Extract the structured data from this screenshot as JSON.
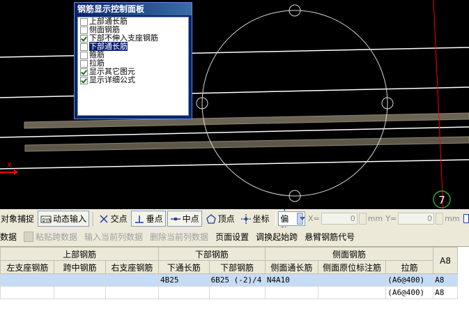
{
  "panel": {
    "title": "钢筋显示控制面板",
    "items": [
      {
        "label": "上部通长筋",
        "checked": false,
        "selected": false
      },
      {
        "label": "侧面钢筋",
        "checked": false,
        "selected": false
      },
      {
        "label": "下部不伸入支座钢筋",
        "checked": true,
        "selected": false
      },
      {
        "label": "下部通长筋",
        "checked": false,
        "selected": true
      },
      {
        "label": "箍筋",
        "checked": false,
        "selected": false
      },
      {
        "label": "拉筋",
        "checked": false,
        "selected": false
      },
      {
        "label": "显示其它图元",
        "checked": true,
        "selected": false
      },
      {
        "label": "显示详细公式",
        "checked": true,
        "selected": false
      }
    ]
  },
  "canvas": {
    "axis_label": "X",
    "marker_label": "7",
    "colors": {
      "bg": "#000000",
      "lines": "#ffffff",
      "beam": "#6b6454",
      "axis": "#ff0000",
      "marker": "#2ea82e"
    }
  },
  "toolbar": {
    "snap": "对象捕捉",
    "dynamic_input": "动态输入",
    "intersection": "交点",
    "perpendicular": "垂点",
    "midpoint": "中点",
    "vertex": "顶点",
    "coordinate": "坐标",
    "offset_mode": "不偏移",
    "x_label": "X=",
    "x_value": "0",
    "y_label": "Y=",
    "y_value": "0",
    "unit": "mm"
  },
  "commands": [
    {
      "label": "数据",
      "enabled": true
    },
    {
      "label": "粘贴跨数据",
      "enabled": false,
      "icon": "paste-icon"
    },
    {
      "label": "输入当前列数据",
      "enabled": false
    },
    {
      "label": "删除当前列数据",
      "enabled": false
    },
    {
      "label": "页面设置",
      "enabled": true
    },
    {
      "label": "调换起始跨",
      "enabled": true
    },
    {
      "label": "悬臂钢筋代号",
      "enabled": true
    }
  ],
  "grid": {
    "groups": [
      "上部钢筋",
      "下部钢筋",
      "侧面钢筋"
    ],
    "columns": [
      "左支座钢筋",
      "跨中钢筋",
      "右支座钢筋",
      "下通长筋",
      "下部钢筋",
      "侧面通长筋",
      "侧面原位标注筋",
      "拉筋",
      "A8"
    ],
    "rows": [
      [
        "",
        "",
        "",
        "4B25",
        "6B25 (-2)/4",
        "N4A10",
        "",
        "(A6@400)",
        "A8"
      ],
      [
        "",
        "",
        "",
        "",
        "",
        "",
        "",
        "(A6@400)",
        "A8"
      ]
    ]
  }
}
